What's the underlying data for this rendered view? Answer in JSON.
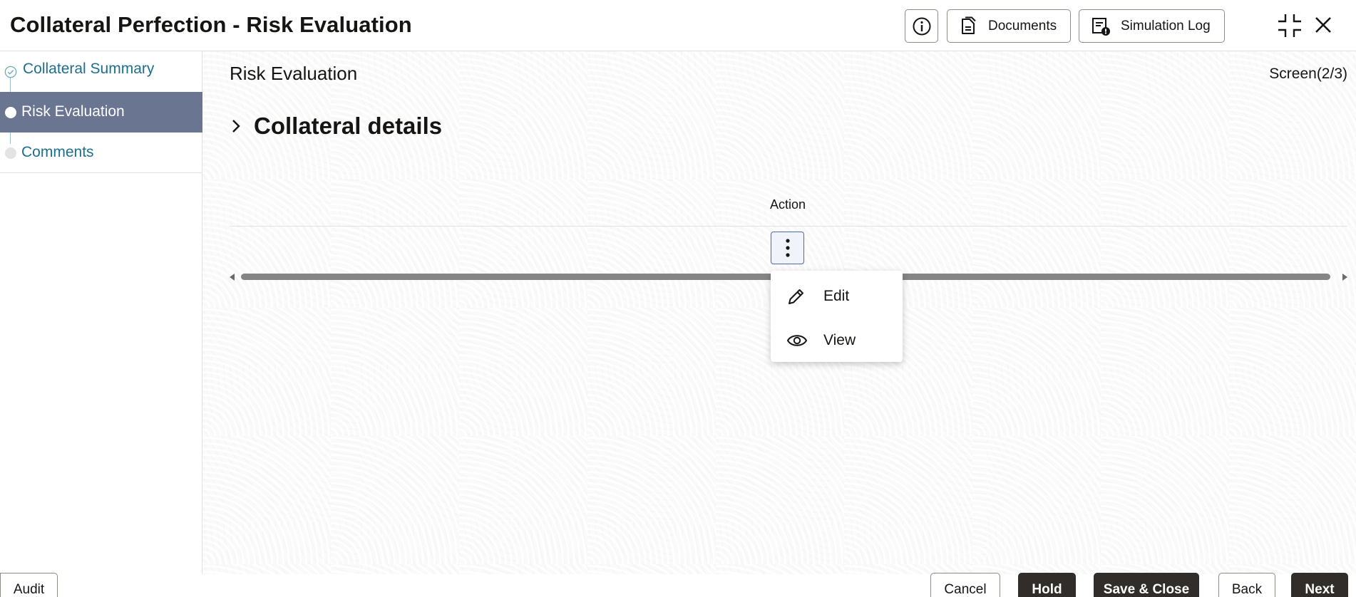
{
  "header": {
    "title": "Collateral Perfection - Risk Evaluation",
    "info_icon": "info-icon",
    "documents_label": "Documents",
    "simulation_log_label": "Simulation Log",
    "collapse_icon": "collapse-icon",
    "close_icon": "close-icon"
  },
  "sidebar": {
    "steps": [
      {
        "label": "Collateral Summary",
        "state": "completed"
      },
      {
        "label": "Risk Evaluation",
        "state": "active"
      },
      {
        "label": "Comments",
        "state": "pending"
      }
    ]
  },
  "main": {
    "page_title": "Risk Evaluation",
    "screen_indicator": "Screen(2/3)",
    "section_title": "Collateral details",
    "table": {
      "columns": [
        "Action"
      ]
    },
    "action_menu": {
      "items": [
        {
          "label": "Edit",
          "icon": "pencil-icon"
        },
        {
          "label": "View",
          "icon": "eye-icon"
        }
      ]
    }
  },
  "footer": {
    "audit_label": "Audit",
    "cancel_label": "Cancel",
    "hold_label": "Hold",
    "save_close_label": "Save & Close",
    "back_label": "Back",
    "next_label": "Next"
  },
  "colors": {
    "active_step_bg": "#6a7592",
    "link_text": "#1c6f8d",
    "dark_button": "#312d2a",
    "kebab_border": "#4d6ba0"
  }
}
